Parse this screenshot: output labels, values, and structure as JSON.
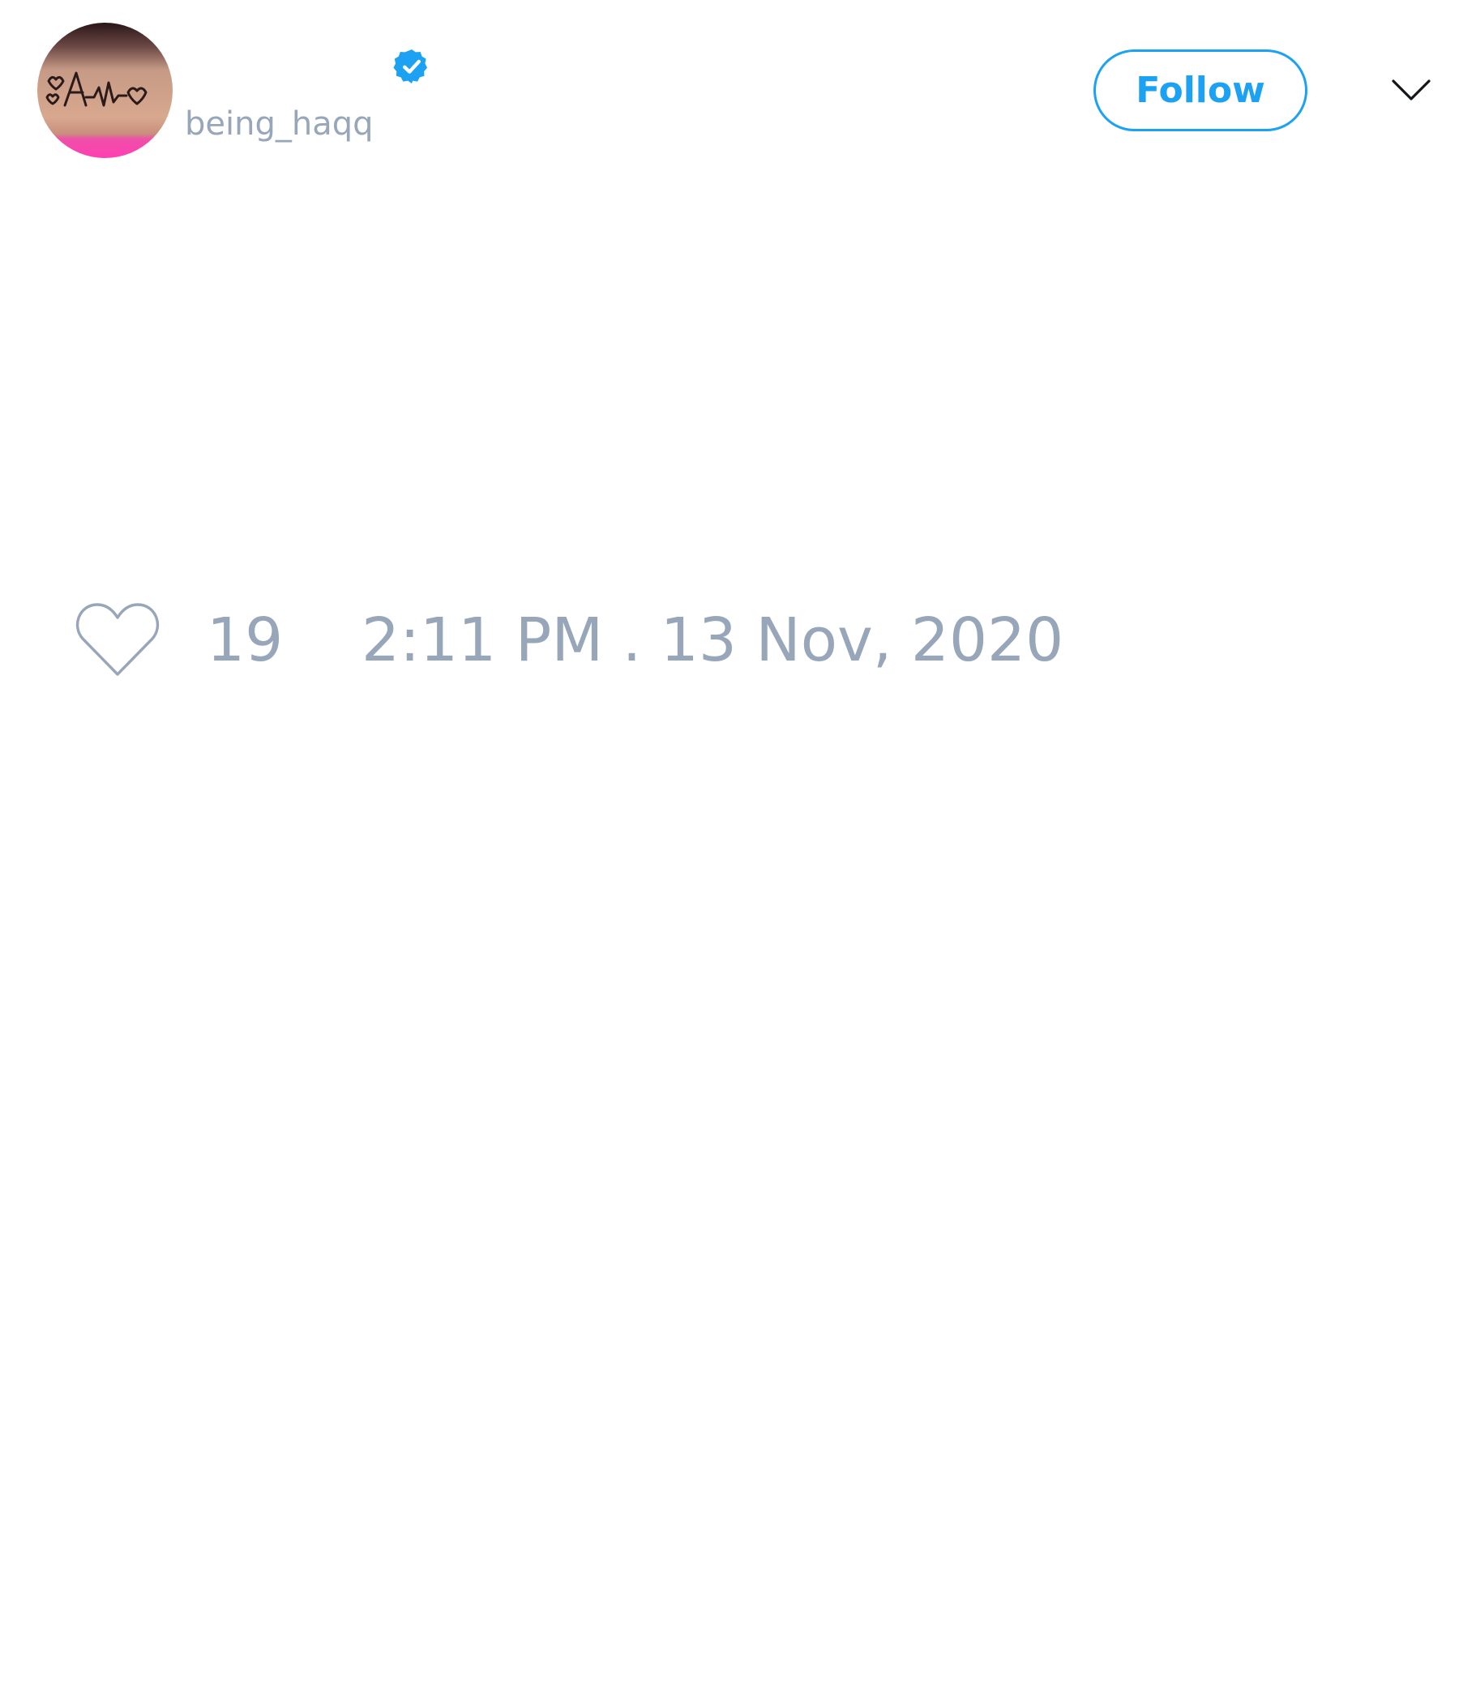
{
  "colors": {
    "accent": "#1da1f2",
    "muted_text": "#98a6ba",
    "background": "#ffffff"
  },
  "header": {
    "avatar_icon": "avatar",
    "display_name": "",
    "verified_icon": "verified-badge-icon",
    "handle": "being_haqq",
    "follow_label": "Follow",
    "menu_icon": "chevron-down-icon"
  },
  "footer": {
    "like_icon": "heart-outline-icon",
    "like_count": "19",
    "timestamp": "2:11 PM . 13 Nov, 2020"
  }
}
